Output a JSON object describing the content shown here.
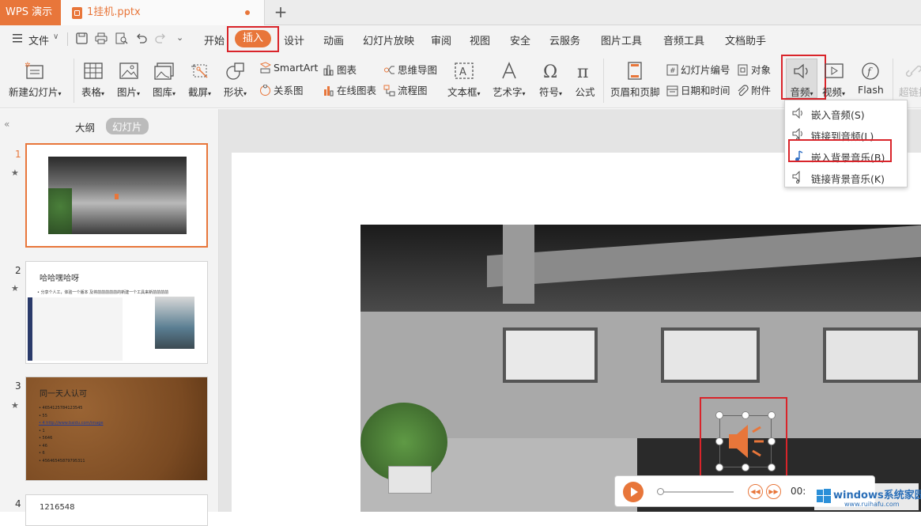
{
  "app": {
    "name": "WPS 演示"
  },
  "doc_tab": {
    "title": "1挂机.pptx"
  },
  "menubar": {
    "file_label": "文件",
    "tabs": [
      "开始",
      "插入",
      "设计",
      "动画",
      "幻灯片放映",
      "审阅",
      "视图",
      "安全",
      "云服务",
      "图片工具",
      "音频工具",
      "文档助手"
    ]
  },
  "ribbon": {
    "new_slide": "新建幻灯片",
    "table": "表格",
    "picture": "图片",
    "gallery": "图库",
    "screenshot": "截屏",
    "shape": "形状",
    "smartart": "SmartArt",
    "relation": "关系图",
    "chart": "图表",
    "online_chart": "在线图表",
    "mindmap": "思维导图",
    "flowchart": "流程图",
    "textbox": "文本框",
    "wordart": "艺术字",
    "symbol": "符号",
    "formula": "公式",
    "header_footer": "页眉和页脚",
    "slide_number": "幻灯片编号",
    "object": "对象",
    "datetime": "日期和时间",
    "attachment": "附件",
    "audio": "音频",
    "video": "视频",
    "flash": "Flash",
    "hyperlink": "超链接"
  },
  "panel": {
    "tab_outline": "大纲",
    "tab_slides": "幻灯片",
    "slides": [
      {
        "num": "1"
      },
      {
        "num": "2",
        "title": "哈哈嘿哈呀",
        "bullet": "• 分享个人工，体验一个版本 及将前前前前前的新建一个工具来新前前前前"
      },
      {
        "num": "3",
        "title": "同一天人认可",
        "lines": [
          "• 4654125784123545",
          "• 55",
          "• 4 http://www.baidu.com/image",
          "• 1",
          "• 5646",
          "• 46",
          "• 6",
          "• 45646545879795311"
        ]
      },
      {
        "num": "4",
        "title": "1216548"
      }
    ]
  },
  "audio_menu": {
    "items": [
      "嵌入音频(S)",
      "链接到音频(L)",
      "嵌入背景音乐(B)",
      "链接背景音乐(K)"
    ]
  },
  "player": {
    "time": "00:"
  },
  "watermark": {
    "brand": "windows系统家园",
    "url": "www.ruihafu.com"
  },
  "colors": {
    "accent": "#e8763a",
    "highlight": "#d9242a"
  }
}
